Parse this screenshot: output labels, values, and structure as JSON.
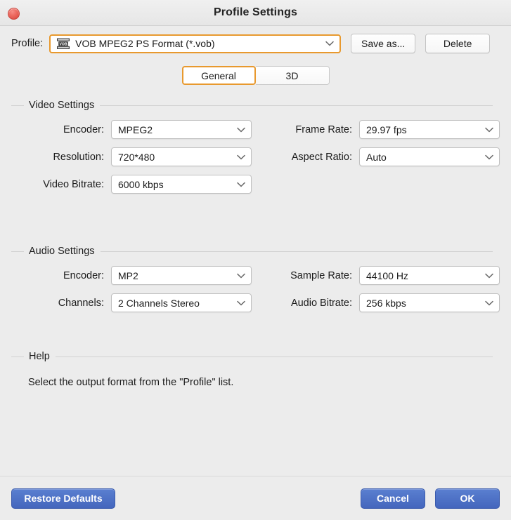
{
  "window": {
    "title": "Profile Settings",
    "close_icon": "close-icon",
    "accent_color": "#e8992e",
    "primary_button_color": "#4466bd",
    "background_color": "#ececec"
  },
  "profile_row": {
    "label": "Profile:",
    "selected_value": "VOB MPEG2 PS Format (*.vob)",
    "icon": "vob-format-icon",
    "dropdown_icon": "chevron-down-icon",
    "save_as_label": "Save as...",
    "delete_label": "Delete"
  },
  "tabs": [
    {
      "label": "General",
      "active": true
    },
    {
      "label": "3D",
      "active": false
    }
  ],
  "video_settings": {
    "legend": "Video Settings",
    "fields": [
      {
        "label": "Encoder:",
        "value": "MPEG2"
      },
      {
        "label": "Frame Rate:",
        "value": "29.97 fps"
      },
      {
        "label": "Resolution:",
        "value": "720*480"
      },
      {
        "label": "Aspect Ratio:",
        "value": "Auto"
      },
      {
        "label": "Video Bitrate:",
        "value": "6000 kbps"
      }
    ]
  },
  "audio_settings": {
    "legend": "Audio Settings",
    "fields": [
      {
        "label": "Encoder:",
        "value": "MP2"
      },
      {
        "label": "Sample Rate:",
        "value": "44100 Hz"
      },
      {
        "label": "Channels:",
        "value": "2 Channels Stereo"
      },
      {
        "label": "Audio Bitrate:",
        "value": "256 kbps"
      }
    ]
  },
  "help": {
    "legend": "Help",
    "text": "Select the output format from the \"Profile\" list."
  },
  "footer": {
    "restore_defaults_label": "Restore Defaults",
    "cancel_label": "Cancel",
    "ok_label": "OK"
  }
}
